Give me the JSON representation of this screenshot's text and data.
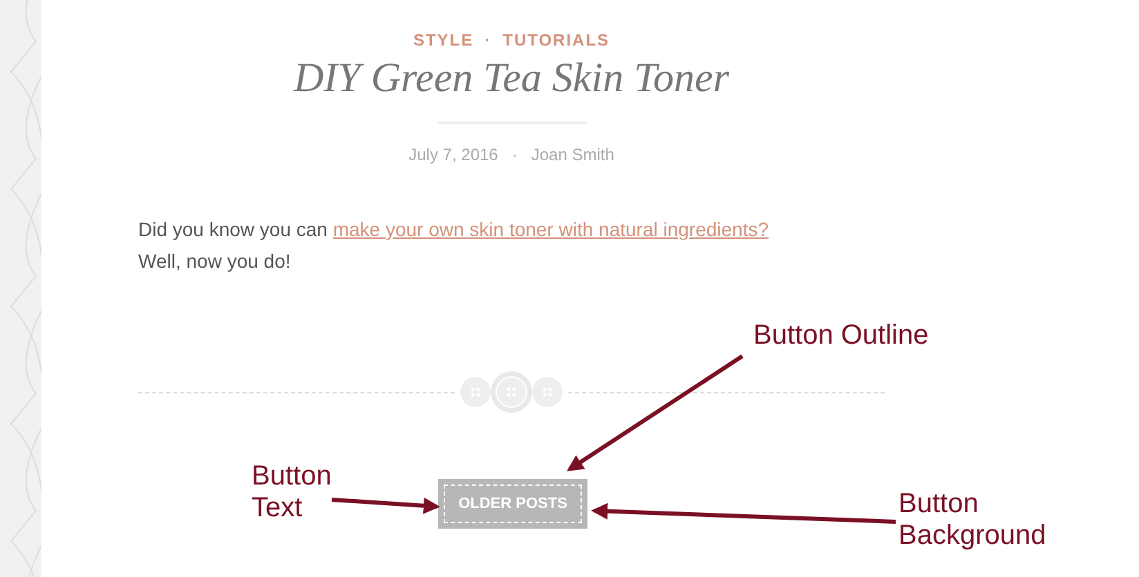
{
  "post": {
    "categories": [
      "STYLE",
      "TUTORIALS"
    ],
    "separator": "·",
    "title": "DIY Green Tea Skin Toner",
    "date": "July 7, 2016",
    "meta_separator": "·",
    "author": "Joan Smith",
    "paragraph": {
      "before": "Did you know you can ",
      "link": "make your own skin toner with natural ingredients?",
      "after": " Well, now you do!"
    }
  },
  "button": {
    "label": "OLDER POSTS"
  },
  "annotations": [
    {
      "text": "Button Outline"
    },
    {
      "text": "Button Text"
    },
    {
      "text": "Button Background"
    }
  ]
}
